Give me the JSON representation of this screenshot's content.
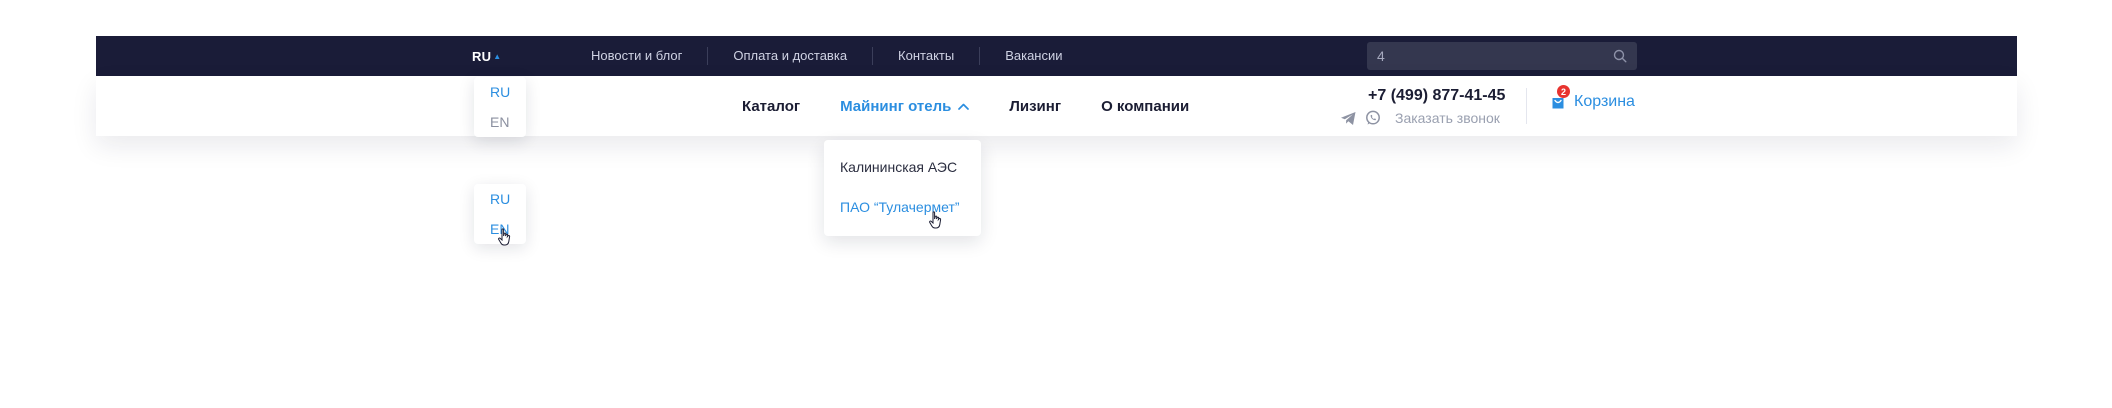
{
  "topbar": {
    "lang_current": "RU",
    "links": [
      "Новости и блог",
      "Оплата и доставка",
      "Контакты",
      "Вакансии"
    ],
    "search": {
      "value": "4",
      "icon": "search-icon"
    }
  },
  "mainnav": {
    "items": [
      "Каталог",
      "Майнинг отель",
      "Лизинг",
      "О компании"
    ],
    "active_index": 1
  },
  "contact": {
    "phone": "+7 (499) 877-41-45",
    "callback": "Заказать звонок",
    "icons": [
      "telegram-icon",
      "whatsapp-icon"
    ]
  },
  "cart": {
    "label": "Корзина",
    "count": "2"
  },
  "lang_dropdown": {
    "options": [
      "RU",
      "EN"
    ]
  },
  "mining_submenu": {
    "items": [
      "Калининская АЭС",
      "ПАО “Тулачермет”"
    ]
  },
  "colors": {
    "accent": "#2b8ee0",
    "topbar": "#1a1c38",
    "badge": "#e8332f"
  }
}
